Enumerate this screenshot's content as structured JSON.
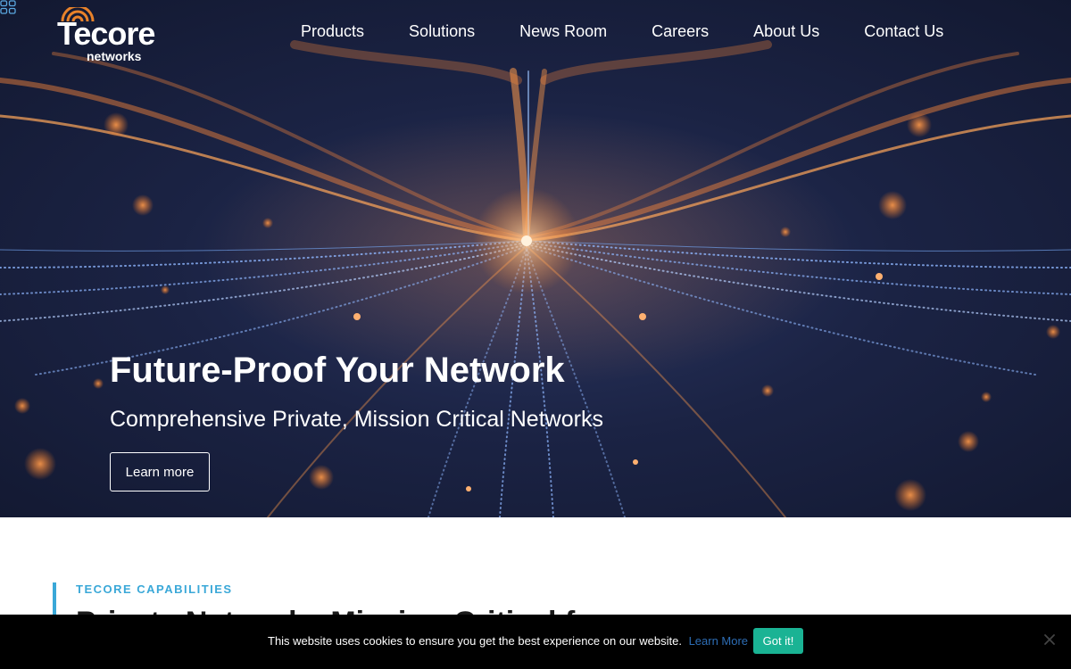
{
  "brand": {
    "name": "Tecore",
    "tagline": "networks",
    "accent_color": "#e8822a"
  },
  "nav": {
    "items": [
      "Products",
      "Solutions",
      "News Room",
      "Careers",
      "About Us",
      "Contact Us"
    ],
    "menu_icon": "grid-icon"
  },
  "hero": {
    "title": "Future-Proof Your Network",
    "subtitle": "Comprehensive Private, Mission Critical Networks",
    "cta_label": "Learn more"
  },
  "capabilities": {
    "eyebrow": "TECORE CAPABILITIES",
    "heading": "Private Networks Mission-Critical for",
    "accent_color": "#3aa8d8"
  },
  "cookie_banner": {
    "message": "This website uses cookies to ensure you get the best experience on our website.",
    "link_label": "Learn More",
    "accept_label": "Got it!",
    "close_icon": "close-icon",
    "button_color": "#1ab394"
  }
}
